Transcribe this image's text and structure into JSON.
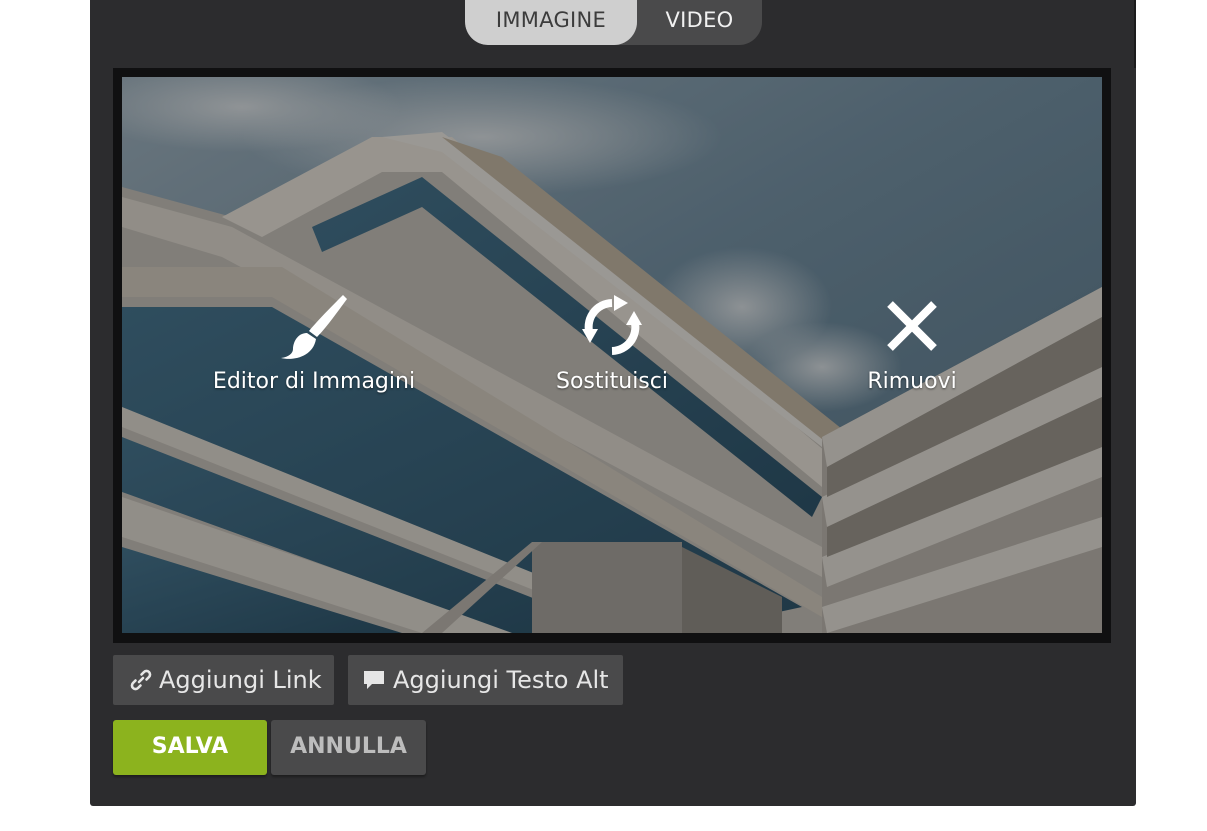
{
  "media_type_toggle": {
    "image_label": "IMMAGINE",
    "video_label": "VIDEO",
    "selected": "IMMAGINE"
  },
  "media_actions": {
    "edit_label": "Editor di Immagini",
    "replace_label": "Sostituisci",
    "remove_label": "Rimuovi",
    "edit_icon": "paintbrush-icon",
    "replace_icon": "refresh-icon",
    "remove_icon": "close-icon"
  },
  "toolbar": {
    "add_link_label": "Aggiungi Link",
    "add_alt_label": "Aggiungi Testo Alt",
    "add_link_icon": "link-icon",
    "add_alt_icon": "speech-bubble-icon"
  },
  "footer": {
    "save_label": "SALVA",
    "cancel_label": "ANNULLA"
  },
  "colors": {
    "panel_bg": "#2c2c2e",
    "button_bg": "#4a4a4b",
    "save_green": "#8cb31e",
    "toggle_selected_bg": "#cfcfcf"
  }
}
